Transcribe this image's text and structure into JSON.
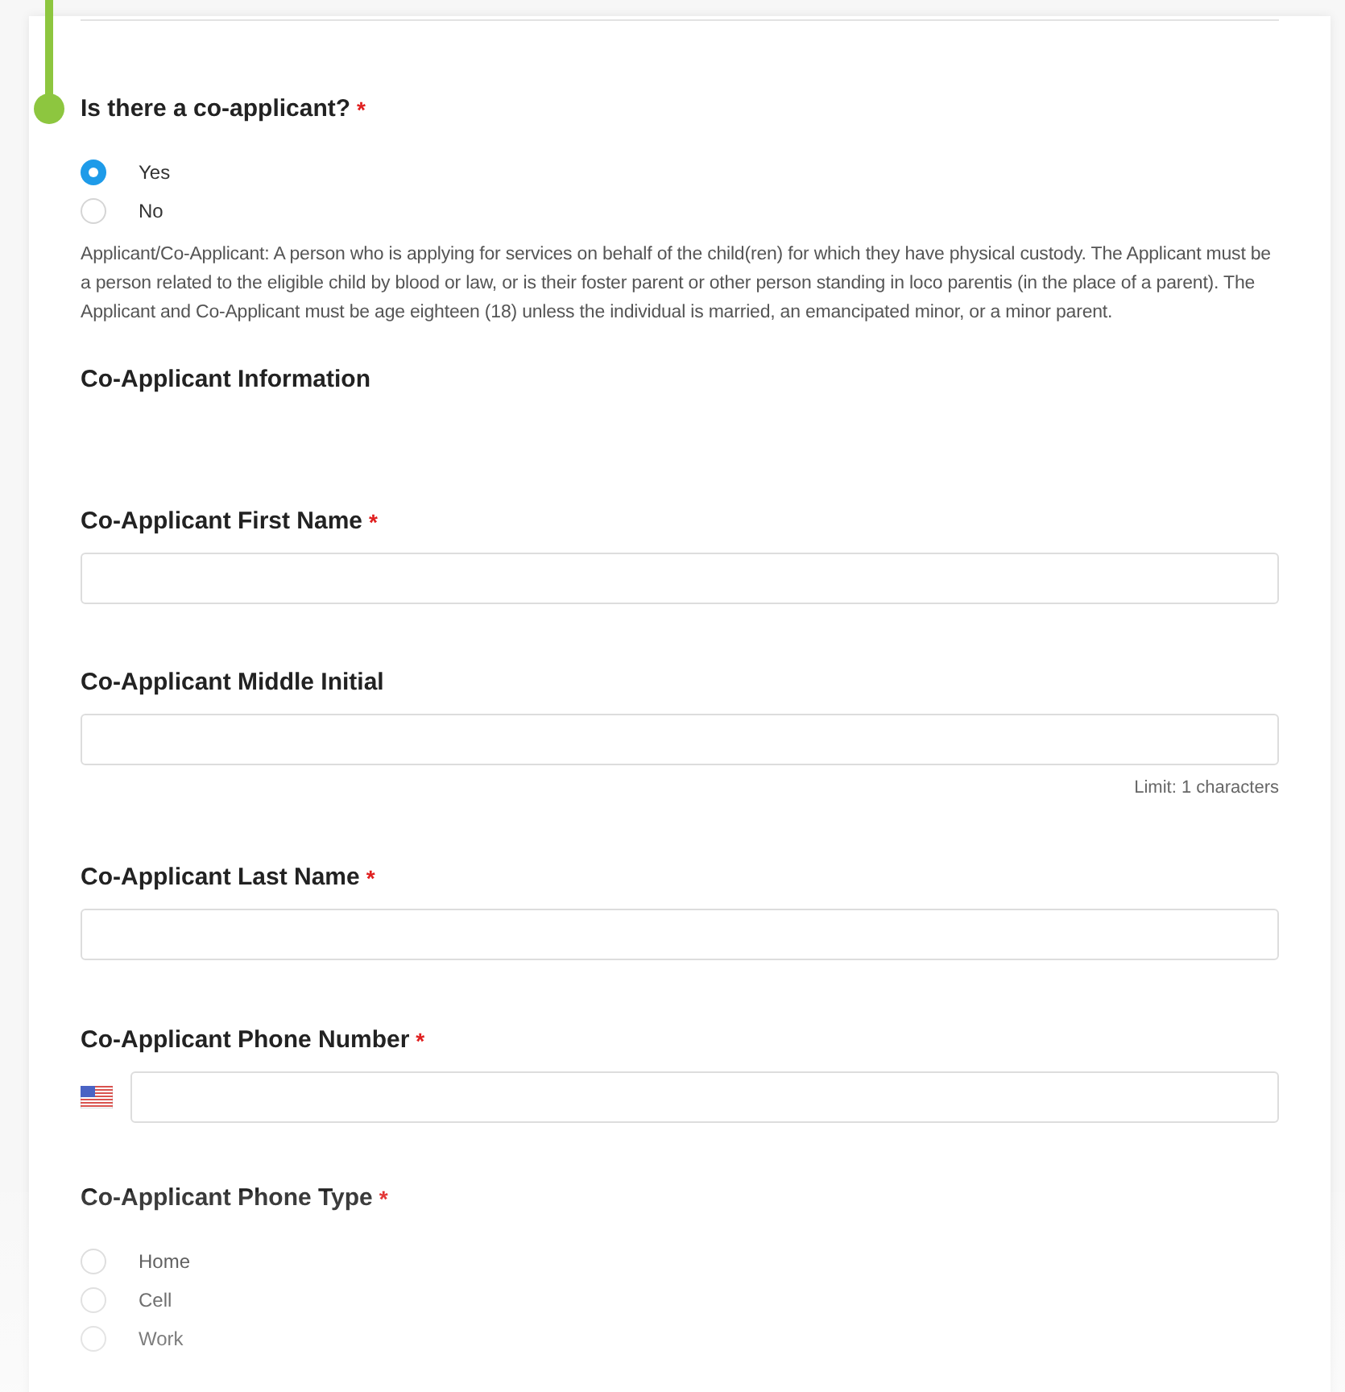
{
  "question": {
    "label": "Is there a co-applicant?",
    "required_mark": "*",
    "options": [
      {
        "label": "Yes",
        "selected": true
      },
      {
        "label": "No",
        "selected": false
      }
    ],
    "description": "Applicant/Co-Applicant: A person who is applying for services on behalf of the child(ren) for which they have physical custody. The Applicant must be a person related to the eligible child by blood or law, or is their foster parent or other person standing in loco parentis (in the place of a parent).  The Applicant and Co-Applicant must be age eighteen (18) unless the individual is married, an emancipated minor, or a minor parent."
  },
  "section_heading": "Co-Applicant Information",
  "fields": [
    {
      "kind": "text",
      "label": "Co-Applicant First Name",
      "required_mark": "*"
    },
    {
      "kind": "text",
      "label": "Co-Applicant Middle Initial",
      "hint": "Limit: 1 characters"
    },
    {
      "kind": "text",
      "label": "Co-Applicant Last Name",
      "required_mark": "*"
    },
    {
      "kind": "phone",
      "label": "Co-Applicant Phone Number",
      "required_mark": "*"
    },
    {
      "kind": "radio",
      "label": "Co-Applicant Phone Type",
      "required_mark": "*",
      "options": [
        {
          "label": "Home",
          "selected": false
        },
        {
          "label": "Cell",
          "selected": false
        },
        {
          "label": "Work",
          "selected": false
        }
      ]
    }
  ]
}
